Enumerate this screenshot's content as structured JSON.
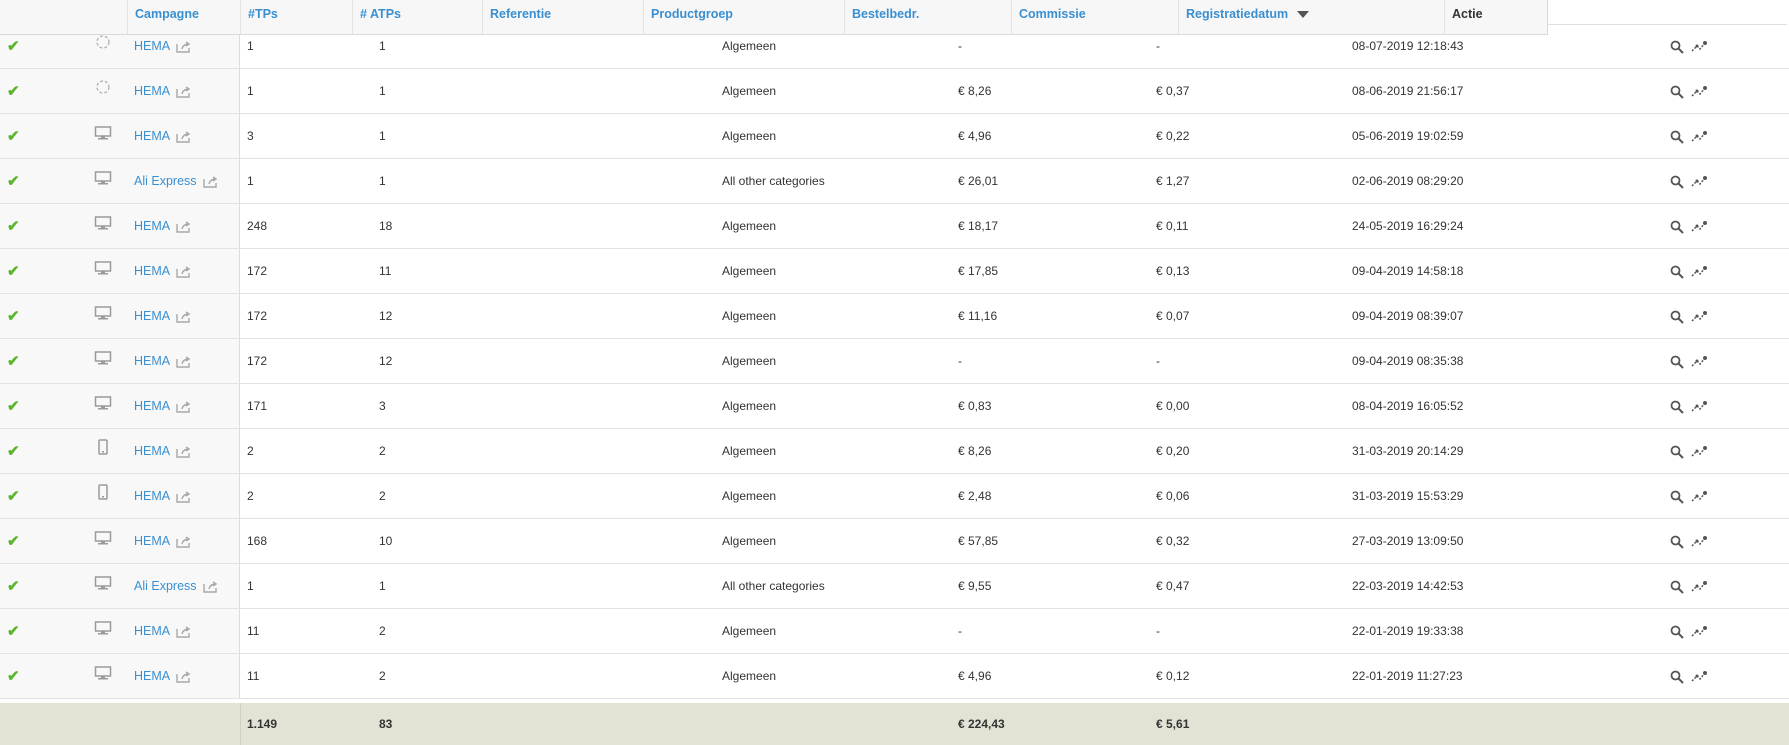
{
  "header": {
    "columns": [
      {
        "key": "campagne",
        "label": "Campagne"
      },
      {
        "key": "tps",
        "label": "#TPs"
      },
      {
        "key": "atps",
        "label": "# ATPs"
      },
      {
        "key": "referentie",
        "label": "Referentie"
      },
      {
        "key": "productgroep",
        "label": "Productgroep"
      },
      {
        "key": "bestelbedr",
        "label": "Bestelbedr."
      },
      {
        "key": "commissie",
        "label": "Commissie"
      },
      {
        "key": "registratiedatum",
        "label": "Registratiedatum"
      },
      {
        "key": "actie",
        "label": "Actie"
      }
    ],
    "sorted_column": "registratiedatum",
    "sort_direction": "descending"
  },
  "colors": {
    "link": "#3a8fd0",
    "check": "#5bb52e",
    "footer_bg": "#e2e2d5"
  },
  "rows": [
    {
      "status": "approved",
      "device": "loading-icon",
      "campaign": "HEMA",
      "tps": "1",
      "atps": "1",
      "productgroep": "Algemeen",
      "bestelbedr": "-",
      "commissie": "-",
      "datum": "08-07-2019 12:18:43"
    },
    {
      "status": "approved",
      "device": "loading-icon",
      "campaign": "HEMA",
      "tps": "1",
      "atps": "1",
      "productgroep": "Algemeen",
      "bestelbedr": "€ 8,26",
      "commissie": "€ 0,37",
      "datum": "08-06-2019 21:56:17"
    },
    {
      "status": "approved",
      "device": "desktop-icon",
      "campaign": "HEMA",
      "tps": "3",
      "atps": "1",
      "productgroep": "Algemeen",
      "bestelbedr": "€ 4,96",
      "commissie": "€ 0,22",
      "datum": "05-06-2019 19:02:59"
    },
    {
      "status": "approved",
      "device": "desktop-icon",
      "campaign": "Ali Express",
      "tps": "1",
      "atps": "1",
      "productgroep": "All other categories",
      "bestelbedr": "€ 26,01",
      "commissie": "€ 1,27",
      "datum": "02-06-2019 08:29:20"
    },
    {
      "status": "approved",
      "device": "desktop-icon",
      "campaign": "HEMA",
      "tps": "248",
      "atps": "18",
      "productgroep": "Algemeen",
      "bestelbedr": "€ 18,17",
      "commissie": "€ 0,11",
      "datum": "24-05-2019 16:29:24"
    },
    {
      "status": "approved",
      "device": "desktop-icon",
      "campaign": "HEMA",
      "tps": "172",
      "atps": "11",
      "productgroep": "Algemeen",
      "bestelbedr": "€ 17,85",
      "commissie": "€ 0,13",
      "datum": "09-04-2019 14:58:18"
    },
    {
      "status": "approved",
      "device": "desktop-icon",
      "campaign": "HEMA",
      "tps": "172",
      "atps": "12",
      "productgroep": "Algemeen",
      "bestelbedr": "€ 11,16",
      "commissie": "€ 0,07",
      "datum": "09-04-2019 08:39:07"
    },
    {
      "status": "approved",
      "device": "desktop-icon",
      "campaign": "HEMA",
      "tps": "172",
      "atps": "12",
      "productgroep": "Algemeen",
      "bestelbedr": "-",
      "commissie": "-",
      "datum": "09-04-2019 08:35:38"
    },
    {
      "status": "approved",
      "device": "desktop-icon",
      "campaign": "HEMA",
      "tps": "171",
      "atps": "3",
      "productgroep": "Algemeen",
      "bestelbedr": "€ 0,83",
      "commissie": "€ 0,00",
      "datum": "08-04-2019 16:05:52"
    },
    {
      "status": "approved",
      "device": "mobile-icon",
      "campaign": "HEMA",
      "tps": "2",
      "atps": "2",
      "productgroep": "Algemeen",
      "bestelbedr": "€ 8,26",
      "commissie": "€ 0,20",
      "datum": "31-03-2019 20:14:29"
    },
    {
      "status": "approved",
      "device": "mobile-icon",
      "campaign": "HEMA",
      "tps": "2",
      "atps": "2",
      "productgroep": "Algemeen",
      "bestelbedr": "€ 2,48",
      "commissie": "€ 0,06",
      "datum": "31-03-2019 15:53:29"
    },
    {
      "status": "approved",
      "device": "desktop-icon",
      "campaign": "HEMA",
      "tps": "168",
      "atps": "10",
      "productgroep": "Algemeen",
      "bestelbedr": "€ 57,85",
      "commissie": "€ 0,32",
      "datum": "27-03-2019 13:09:50"
    },
    {
      "status": "approved",
      "device": "desktop-icon",
      "campaign": "Ali Express",
      "tps": "1",
      "atps": "1",
      "productgroep": "All other categories",
      "bestelbedr": "€ 9,55",
      "commissie": "€ 0,47",
      "datum": "22-03-2019 14:42:53"
    },
    {
      "status": "approved",
      "device": "desktop-icon",
      "campaign": "HEMA",
      "tps": "11",
      "atps": "2",
      "productgroep": "Algemeen",
      "bestelbedr": "-",
      "commissie": "-",
      "datum": "22-01-2019 19:33:38"
    },
    {
      "status": "approved",
      "device": "desktop-icon",
      "campaign": "HEMA",
      "tps": "11",
      "atps": "2",
      "productgroep": "Algemeen",
      "bestelbedr": "€ 4,96",
      "commissie": "€ 0,12",
      "datum": "22-01-2019 11:27:23"
    }
  ],
  "totals": {
    "tps": "1.149",
    "atps": "83",
    "bestelbedr": "€ 224,43",
    "commissie": "€ 5,61"
  },
  "icons": {
    "status": "check-icon",
    "external": "external-link-icon",
    "view": "search-icon",
    "track": "tracking-icon"
  }
}
